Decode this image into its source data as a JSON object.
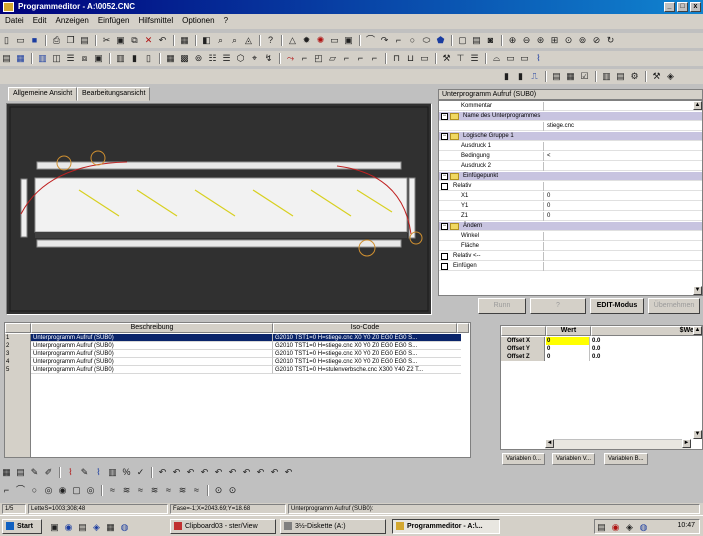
{
  "window": {
    "title": "Programmeditor - A:\\0052.CNC",
    "btn_min": "_",
    "btn_max": "□",
    "btn_close": "x"
  },
  "menu": [
    "Datei",
    "Edit",
    "Anzeigen",
    "Einfügen",
    "Hilfsmittel",
    "Optionen",
    "?"
  ],
  "toolbar_icons": {
    "row1": [
      "new-icon",
      "open-icon",
      "save-icon",
      "print-icon",
      "copy-icon",
      "paste-icon",
      "cut-icon",
      "delete-icon",
      "undo-icon",
      "grid-icon",
      "view-icon",
      "find-icon",
      "help-icon",
      "triangle-icon",
      "gear-icon",
      "rect-icon",
      "arc-icon",
      "line-icon",
      "circle-icon",
      "frame-icon",
      "zoom-in-icon",
      "zoom-out-icon",
      "zoom-all-icon",
      "zoom-window-icon",
      "redraw-icon"
    ],
    "row2": [
      "table-icon",
      "insert-icon",
      "column-icon",
      "split-icon",
      "align-icon",
      "mirror-icon",
      "rotate-icon",
      "snap-icon",
      "measure-icon",
      "dim-icon",
      "text-icon",
      "layer-icon",
      "hatch-icon",
      "contour-icon"
    ],
    "row3": [
      "prog-icon",
      "sub-icon",
      "loop-icon",
      "var-icon",
      "check-icon",
      "run-icon",
      "config-icon"
    ]
  },
  "tabs": {
    "view_general": "Allgemeine Ansicht",
    "view_machining": "Bearbeitungsansicht"
  },
  "properties": {
    "header": "Unterprogramm Aufruf (SUB0)",
    "rows": [
      {
        "label": "Kommentar",
        "value": "",
        "kind": "plain"
      },
      {
        "label": "Name des Unterprogrammes",
        "value": "",
        "kind": "group"
      },
      {
        "label": "",
        "value": "stiege.cnc",
        "kind": "plain"
      },
      {
        "label": "Logische Gruppe 1",
        "value": "",
        "kind": "group"
      },
      {
        "label": "Ausdruck 1",
        "value": "",
        "kind": "indent"
      },
      {
        "label": "Bedingung",
        "value": "<",
        "kind": "indent"
      },
      {
        "label": "Ausdruck 2",
        "value": "",
        "kind": "indent"
      },
      {
        "label": "Einfügepunkt",
        "value": "",
        "kind": "group"
      },
      {
        "label": "Relativ",
        "value": "",
        "kind": "check"
      },
      {
        "label": "X1",
        "value": "0",
        "kind": "indent"
      },
      {
        "label": "Y1",
        "value": "0",
        "kind": "indent"
      },
      {
        "label": "Z1",
        "value": "0",
        "kind": "indent"
      },
      {
        "label": "Ändern",
        "value": "",
        "kind": "group"
      },
      {
        "label": "Winkel",
        "value": "",
        "kind": "indent"
      },
      {
        "label": "Fläche",
        "value": "",
        "kind": "indent"
      },
      {
        "label": "Relativ <--",
        "value": "",
        "kind": "check"
      },
      {
        "label": "Einfügen",
        "value": "",
        "kind": "check"
      }
    ]
  },
  "prop_buttons": {
    "b1": "Runn",
    "b2": "?",
    "b3": "EDIT-Modus",
    "b4": "Übernehmen"
  },
  "table": {
    "col_desc": "Beschreibung",
    "col_iso": "Iso-Code",
    "rows": [
      {
        "n": "1",
        "desc": "Unterprogramm Aufruf (SUB0)",
        "iso": "G2010 TST1=0 H=stiege.cnc X0 Y0 Z0 EG0 EG0 S..."
      },
      {
        "n": "2",
        "desc": "Unterprogramm Aufruf (SUB0)",
        "iso": "G2010 TST1=0 H=stiege.cnc X0 Y0 Z0 EG0 EG0 S..."
      },
      {
        "n": "3",
        "desc": "Unterprogramm Aufruf (SUB0)",
        "iso": "G2010 TST1=0 H=stiege.cnc X0 Y0 Z0 EG0 EG0 S..."
      },
      {
        "n": "4",
        "desc": "Unterprogramm Aufruf (SUB0)",
        "iso": "G2010 TST1=0 H=stiege.cnc X0 Y0 Z0 EG0 EG0 S..."
      },
      {
        "n": "5",
        "desc": "Unterprogramm Aufruf (SUB0)",
        "iso": "G2010 TST1=0 H=stulenverbsche.cnc X300 Y40 Z2 T..."
      }
    ]
  },
  "offsets": {
    "col_wert": "Wert",
    "col_swert": "$Wert",
    "rows": [
      {
        "name": "Offset X",
        "wert": "0",
        "swert": "0.0"
      },
      {
        "name": "Offset Y",
        "wert": "0",
        "swert": "0.0"
      },
      {
        "name": "Offset Z",
        "wert": "0",
        "swert": "0.0"
      }
    ]
  },
  "var_tabs": [
    "Variablen 0...",
    "Variablen V...",
    "Variablen B..."
  ],
  "status": {
    "mode": "1/5",
    "linear": "LetteS=1003;308;48",
    "pos": "Fase=-1;X=2043.69;Y=18.68",
    "info": "Unterprogramm Aufruf (SUB0):"
  },
  "taskbar": {
    "start": "Start",
    "tasks": [
      "Clipboard03 - ster/View",
      "3½-Diskette (A:)",
      "Programmeditor - A:\\..."
    ],
    "clock": "10:47"
  },
  "colors": {
    "title_start": "#00007b",
    "title_end": "#1084d0",
    "viewport": "#303030",
    "offset_highlight": "#ffff00",
    "selection": "#0a246a"
  }
}
